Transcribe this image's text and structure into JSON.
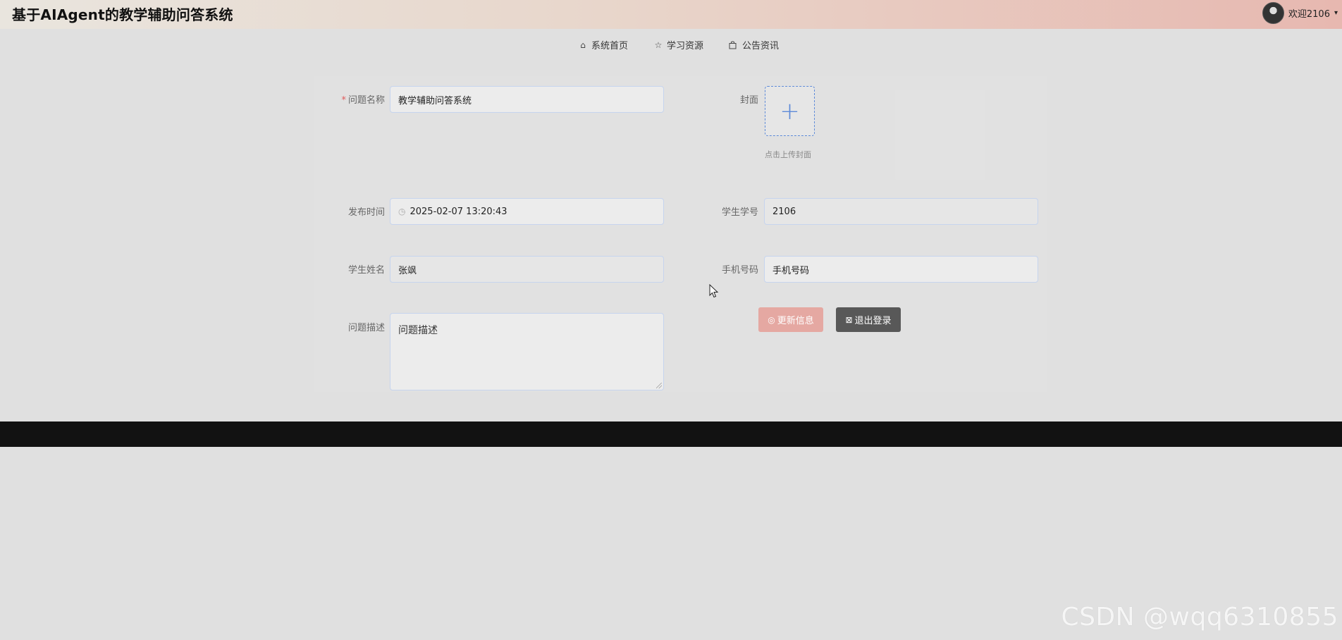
{
  "header": {
    "title": "基于AIAgent的教学辅助问答系统",
    "welcome": "欢迎2106",
    "caret": "▾"
  },
  "nav": {
    "items": [
      {
        "label": "系统首页",
        "icon": "home-icon"
      },
      {
        "label": "学习资源",
        "icon": "star-icon"
      },
      {
        "label": "公告资讯",
        "icon": "bag-icon"
      }
    ]
  },
  "form": {
    "question_name": {
      "label": "问题名称",
      "required_mark": "*",
      "value": "教学辅助问答系统"
    },
    "cover": {
      "label": "封面",
      "hint": "点击上传封面"
    },
    "publish_time": {
      "label": "发布时间",
      "value": "2025-02-07 13:20:43"
    },
    "student_id": {
      "label": "学生学号",
      "value": "2106"
    },
    "student_name": {
      "label": "学生姓名",
      "value": "张飒"
    },
    "phone": {
      "label": "手机号码",
      "placeholder": "手机号码"
    },
    "description": {
      "label": "问题描述",
      "placeholder": "问题描述"
    }
  },
  "buttons": {
    "update": "更新信息",
    "logout": "退出登录"
  },
  "watermark": "CSDN @wqq6310855",
  "colors": {
    "accent": "#5d8ad8",
    "update_button": "#e5a8a2",
    "logout_button": "#585858",
    "footer": "#121212"
  }
}
